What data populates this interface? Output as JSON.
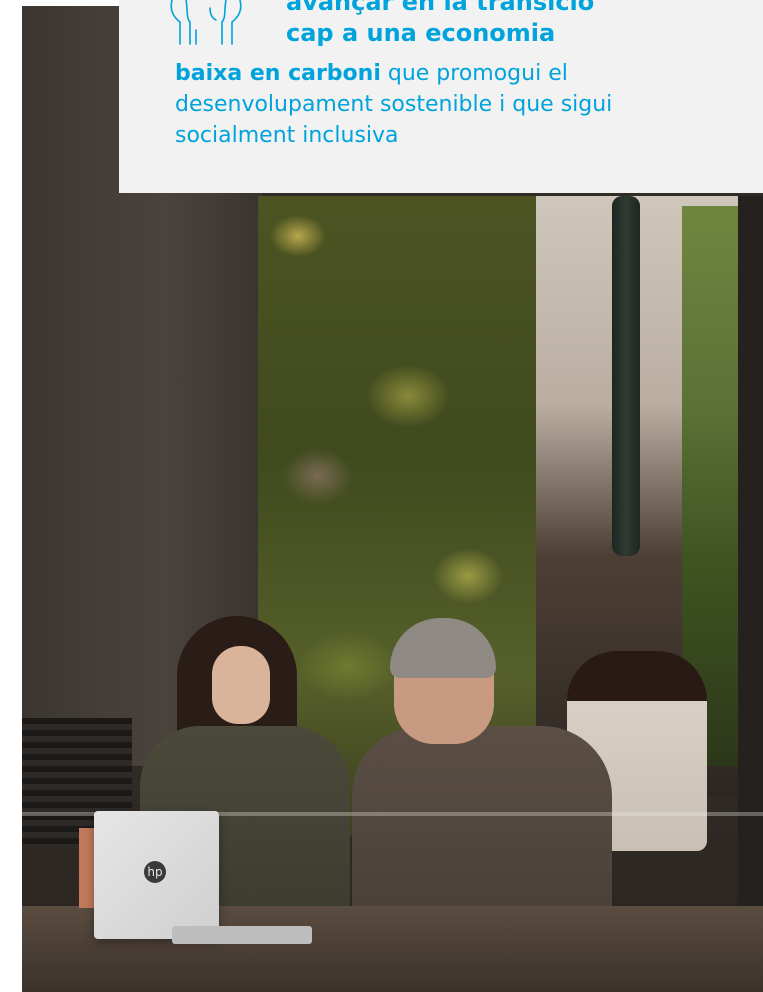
{
  "callout": {
    "heading_line_1": "avançar en la transició",
    "heading_line_2": "cap a una economia",
    "body_highlight": "baixa en carboni",
    "body_text": " que promogui el desenvolupament sostenible i que sigui socialment inclusiva",
    "text_color": "#00a3dc",
    "box_color": "#f2f2f2",
    "icon": "hands-raised-icon"
  },
  "photo": {
    "laptop_logo": "hp",
    "description_colors": {
      "plants": "#4d5422",
      "wall": "#3c3631"
    }
  }
}
